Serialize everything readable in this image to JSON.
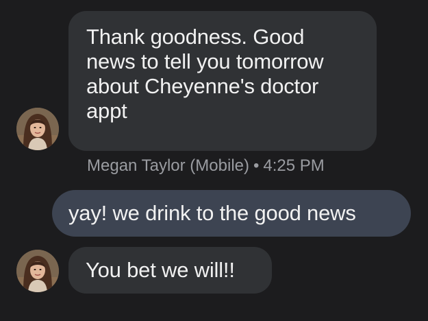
{
  "messages": [
    {
      "direction": "incoming",
      "text": "Thank goodness. Good news to tell you tomorrow about Cheyenne's doctor appt",
      "sender": "Megan Taylor (Mobile)",
      "time": "4:25 PM",
      "separator": "•"
    },
    {
      "direction": "outgoing",
      "text": "yay! we drink to the good news"
    },
    {
      "direction": "incoming",
      "text": "You bet we will!!"
    }
  ],
  "colors": {
    "background": "#1c1c1e",
    "incoming_bubble": "#303235",
    "outgoing_bubble": "#3d4452",
    "meta_text": "#9a9ca1"
  },
  "icons": {
    "avatar": "contact-photo"
  }
}
